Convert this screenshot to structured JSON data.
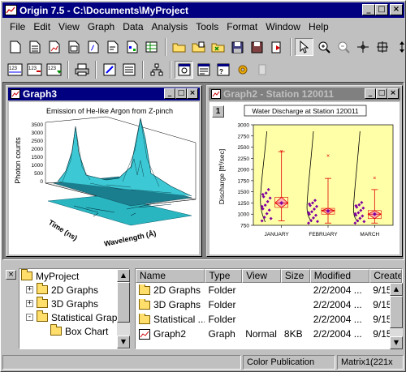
{
  "app": {
    "title": "Origin 7.5 - C:\\Documents\\MyProject",
    "accent": "#000080",
    "inactive_title": "#808080"
  },
  "menu": [
    "File",
    "Edit",
    "View",
    "Graph",
    "Data",
    "Analysis",
    "Tools",
    "Format",
    "Window",
    "Help"
  ],
  "window_buttons": {
    "minimize": "_",
    "maximize": "□",
    "close": "×"
  },
  "graph3": {
    "title": "Graph3",
    "plot_title": "Emission of He-like Argon from Z-pinch",
    "zlabel": "Photon counts",
    "zticks": [
      "3500",
      "3000",
      "2500",
      "2000",
      "1500",
      "1000",
      "500",
      "0"
    ],
    "ylabel": "Time (ns)",
    "xlabel": "Wavelength (Å)"
  },
  "graph2": {
    "title": "Graph2 - Station 120011",
    "layer": "1",
    "plot_title": "Water Discharge at Station 120011",
    "ylabel": "Discharge [ft³/sec]",
    "yticks": [
      "3000",
      "2750",
      "2500",
      "2250",
      "2000",
      "1750",
      "1500",
      "1250",
      "1000",
      "750"
    ],
    "categories": [
      "JANUARY",
      "FEBRUARY",
      "MARCH"
    ]
  },
  "chart_data": {
    "type": "box",
    "title": "Water Discharge at Station 120011",
    "ylabel": "Discharge [ft³/sec]",
    "ylim": [
      750,
      3000
    ],
    "categories": [
      "JANUARY",
      "FEBRUARY",
      "MARCH"
    ],
    "boxes": [
      {
        "category": "JANUARY",
        "q1": 1150,
        "median": 1250,
        "q3": 1380,
        "whisker_low": 850,
        "whisker_high": 2400,
        "mean": 1250,
        "outlier": 2400
      },
      {
        "category": "FEBRUARY",
        "q1": 1000,
        "median": 1080,
        "q3": 1130,
        "whisker_low": 800,
        "whisker_high": 1800,
        "mean": 1070,
        "outlier": 2300
      },
      {
        "category": "MARCH",
        "q1": 900,
        "median": 1000,
        "q3": 1080,
        "whisker_low": 800,
        "whisker_high": 1550,
        "mean": 1000,
        "outlier": 1800
      }
    ]
  },
  "project_tree": {
    "items": [
      {
        "label": "MyProject",
        "expand": ""
      },
      {
        "label": "2D Graphs",
        "expand": "+"
      },
      {
        "label": "3D Graphs",
        "expand": "+"
      },
      {
        "label": "Statistical Graphs",
        "expand": "-"
      },
      {
        "label": "Box Chart",
        "expand": ""
      }
    ]
  },
  "file_list": {
    "columns": [
      "Name",
      "Type",
      "View",
      "Size",
      "Modified",
      "Created"
    ],
    "rows": [
      {
        "name": "2D Graphs",
        "type": "Folder",
        "view": "",
        "size": "",
        "modified": "2/2/2004 ...",
        "created": "9/15"
      },
      {
        "name": "3D Graphs",
        "type": "Folder",
        "view": "",
        "size": "",
        "modified": "2/2/2004 ...",
        "created": "9/15"
      },
      {
        "name": "Statistical ...",
        "type": "Folder",
        "view": "",
        "size": "",
        "modified": "2/2/2004 ...",
        "created": "9/15"
      },
      {
        "name": "Graph2",
        "type": "Graph",
        "view": "Normal",
        "size": "8KB",
        "modified": "2/2/2004 ...",
        "created": "9/15"
      }
    ]
  },
  "status": {
    "left": "",
    "mode": "Color Publication",
    "active": "Matrix1(221x"
  }
}
